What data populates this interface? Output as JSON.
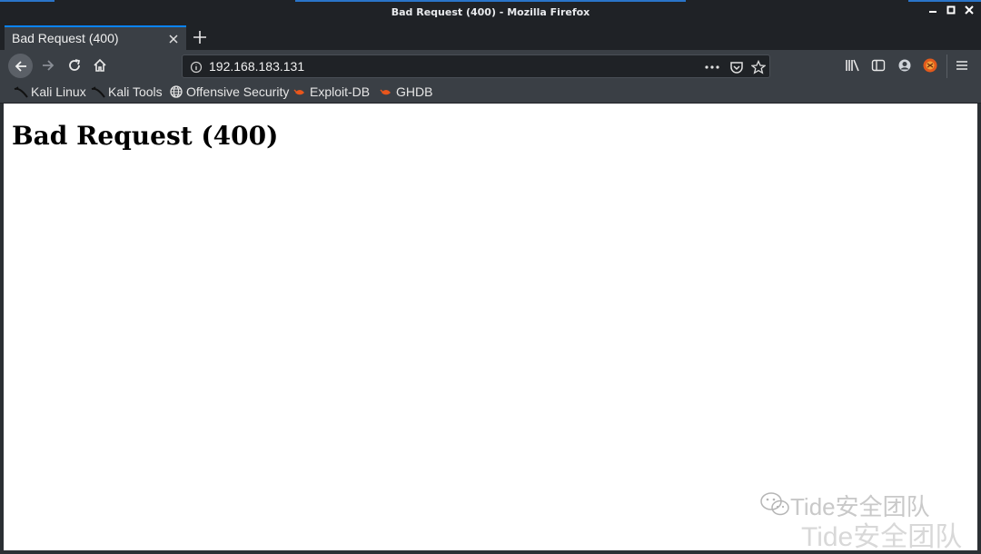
{
  "window": {
    "title": "Bad Request (400) - Mozilla Firefox",
    "controls": [
      "minimize",
      "maximize",
      "close"
    ]
  },
  "tabs": [
    {
      "label": "Bad Request (400)",
      "active": true
    }
  ],
  "toolbar": {
    "back_icon": "back-arrow-icon",
    "forward_icon": "forward-arrow-icon",
    "reload_icon": "reload-icon",
    "home_icon": "home-icon"
  },
  "urlbar": {
    "url": "192.168.183.131"
  },
  "bookmarks": [
    {
      "label": "Kali Linux",
      "icon": "kali-dragon-icon"
    },
    {
      "label": "Kali Tools",
      "icon": "kali-dragon-icon"
    },
    {
      "label": "Offensive Security",
      "icon": "globe-icon"
    },
    {
      "label": "Exploit-DB",
      "icon": "exploit-db-icon"
    },
    {
      "label": "GHDB",
      "icon": "exploit-db-icon"
    }
  ],
  "page": {
    "heading": "Bad Request (400)"
  },
  "watermark": {
    "line1": "Tide安全团队",
    "line2": "Tide安全团队"
  },
  "colors": {
    "accent": "#0a84ff",
    "chrome": "#3a3f45",
    "titlebar": "#1f2226"
  }
}
